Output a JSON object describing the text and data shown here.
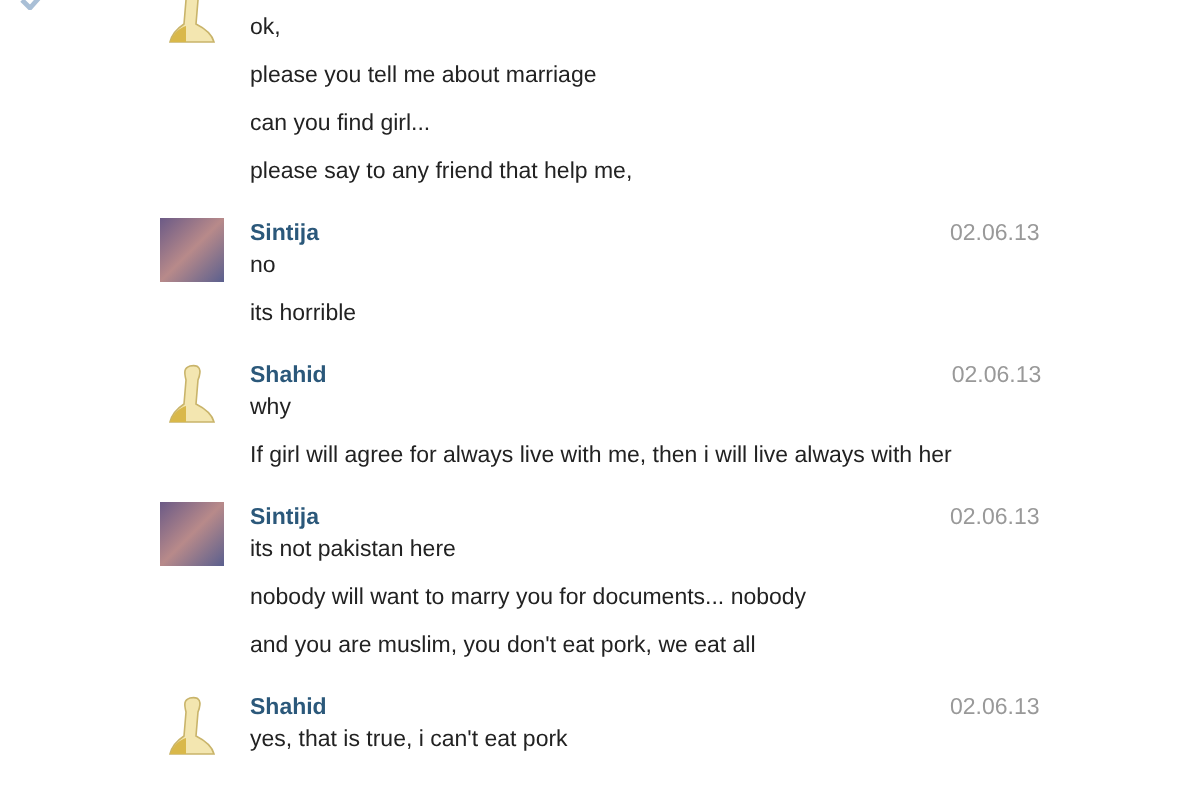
{
  "messages": [
    {
      "checked": true,
      "kind": "banana",
      "lines": [
        "ok,",
        "please you tell me about marriage",
        "can you find girl...",
        "please say to any friend that help me,"
      ]
    },
    {
      "checked": false,
      "kind": "photo",
      "sender": "Sintija",
      "date": "02.06.13",
      "lines": [
        "no",
        "its horrible"
      ]
    },
    {
      "checked": false,
      "kind": "banana",
      "sender": "Shahid",
      "date": "02.06.13",
      "lines": [
        "why",
        "If girl will agree for always live with me, then i will live always with her"
      ]
    },
    {
      "checked": false,
      "kind": "photo",
      "sender": "Sintija",
      "date": "02.06.13",
      "lines": [
        "its not pakistan here",
        "nobody will want to marry you for documents... nobody",
        "and you are muslim, you don't eat pork, we eat all"
      ]
    },
    {
      "checked": false,
      "kind": "banana",
      "sender": "Shahid",
      "date": "02.06.13",
      "lines": [
        "yes, that is true, i can't eat pork"
      ]
    }
  ]
}
